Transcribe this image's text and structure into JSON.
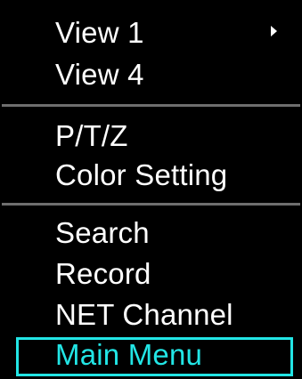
{
  "menu": {
    "items": [
      {
        "label": "View 1",
        "has_submenu": true
      },
      {
        "label": "View 4"
      },
      {
        "label": "P/T/Z"
      },
      {
        "label": "Color Setting"
      },
      {
        "label": "Search"
      },
      {
        "label": "Record"
      },
      {
        "label": "NET Channel"
      },
      {
        "label": "Main Menu",
        "selected": true
      }
    ]
  },
  "colors": {
    "background": "#000000",
    "text": "#ffffff",
    "selected_text": "#22e5e5",
    "divider": "#6e6e6e",
    "selection_border": "#22e5e5"
  },
  "icons": {
    "submenu": "chevron-right-icon"
  }
}
